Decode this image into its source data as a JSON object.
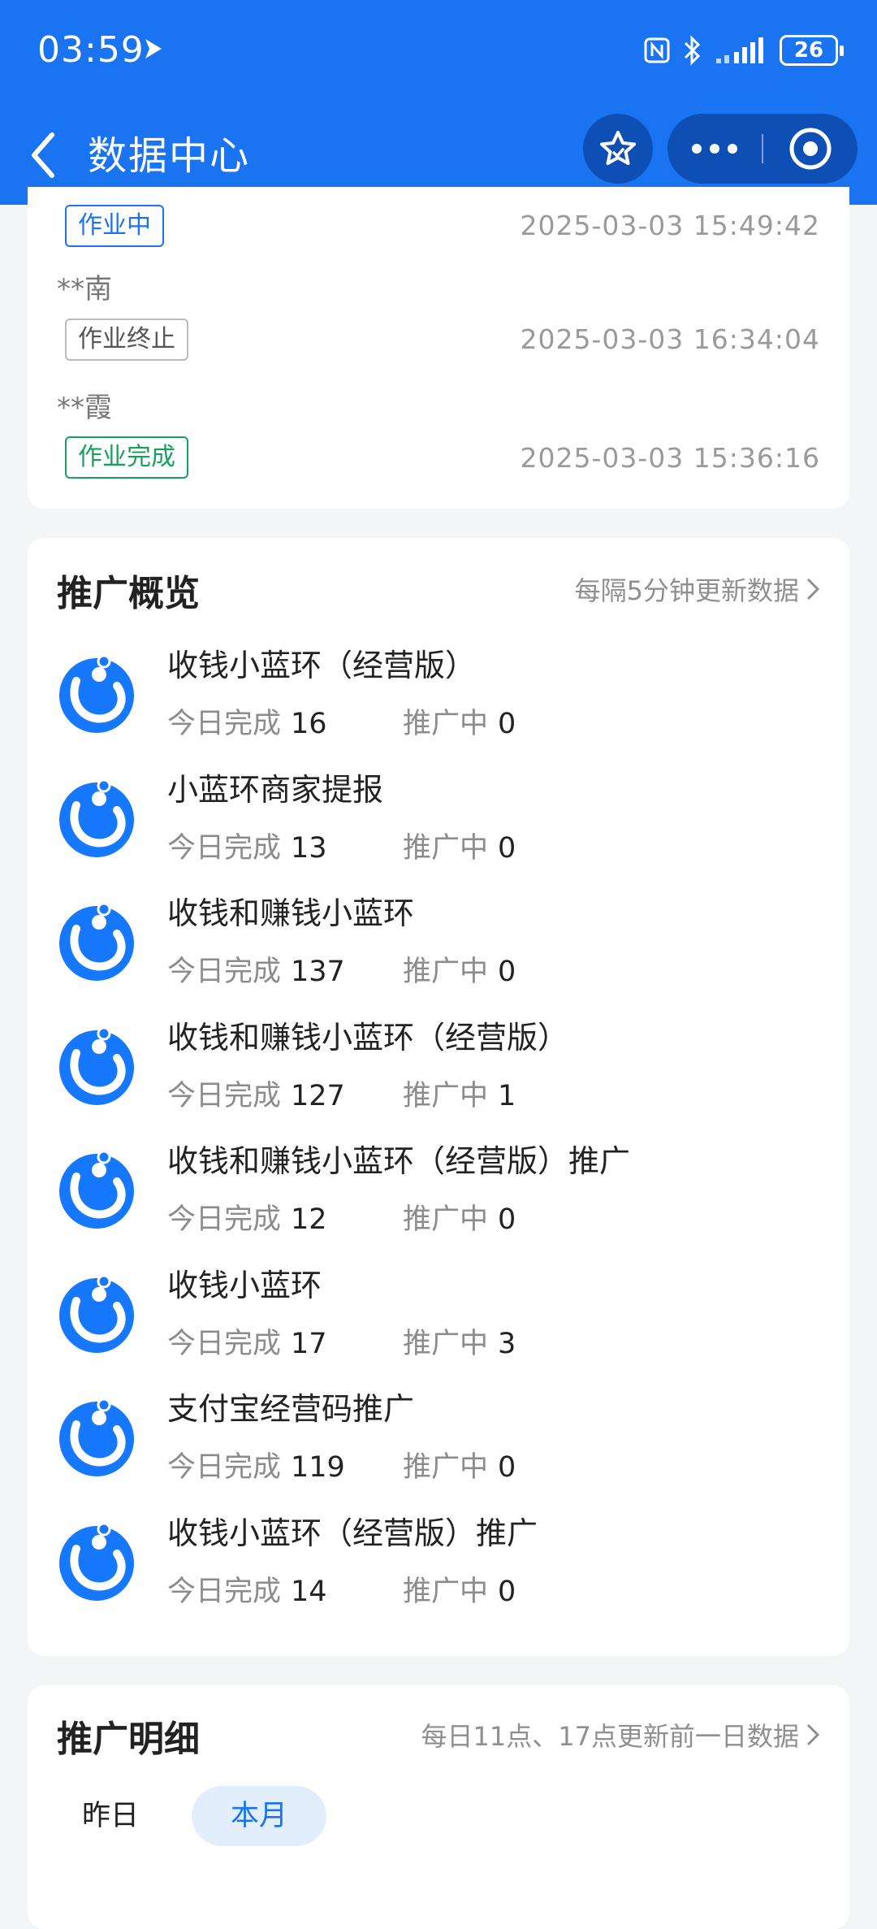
{
  "status_bar": {
    "time": "03:59",
    "battery": "26",
    "icons": [
      "nfc-icon",
      "bluetooth-icon",
      "signal-icon"
    ]
  },
  "nav": {
    "title": "数据中心",
    "icons": [
      "back-arrow-icon",
      "star-icon",
      "more-dots-icon",
      "close-circle-icon"
    ]
  },
  "work_records": [
    {
      "name": "",
      "status": "作业中",
      "status_color": "#1a73f0",
      "time": "2025-03-03 15:49:42"
    },
    {
      "name": "**南",
      "status": "作业终止",
      "status_color": "#555555",
      "time": "2025-03-03 16:34:04"
    },
    {
      "name": "**霞",
      "status": "作业完成",
      "status_color": "#16a05d",
      "time": "2025-03-03 15:36:16"
    }
  ],
  "overview": {
    "title": "推广概览",
    "link": "每隔5分钟更新数据",
    "done_label": "今日完成",
    "promoting_label": "推广中",
    "items": [
      {
        "name": "收钱小蓝环（经营版）",
        "done": "16",
        "promoting": "0"
      },
      {
        "name": "小蓝环商家提报",
        "done": "13",
        "promoting": "0"
      },
      {
        "name": "收钱和赚钱小蓝环",
        "done": "137",
        "promoting": "0"
      },
      {
        "name": "收钱和赚钱小蓝环（经营版）",
        "done": "127",
        "promoting": "1"
      },
      {
        "name": "收钱和赚钱小蓝环（经营版）推广",
        "done": "12",
        "promoting": "0"
      },
      {
        "name": "收钱小蓝环",
        "done": "17",
        "promoting": "3"
      },
      {
        "name": "支付宝经营码推广",
        "done": "119",
        "promoting": "0"
      },
      {
        "name": "收钱小蓝环（经营版）推广",
        "done": "14",
        "promoting": "0"
      }
    ]
  },
  "detail": {
    "title": "推广明细",
    "link": "每日11点、17点更新前一日数据",
    "tabs": [
      {
        "label": "昨日",
        "active": false
      },
      {
        "label": "本月",
        "active": true
      }
    ]
  },
  "colors": {
    "brand_blue": "#1a73f0",
    "capsule": "#0e4fb6",
    "success_green": "#16a05d"
  }
}
